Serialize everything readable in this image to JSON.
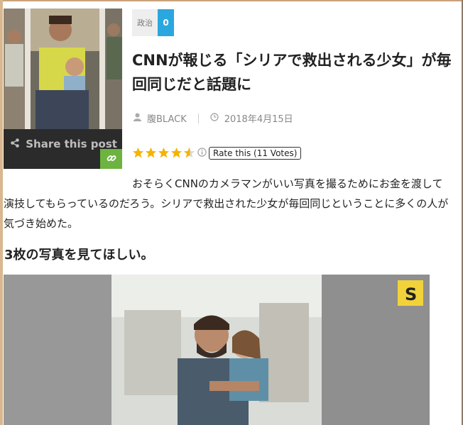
{
  "thumbnail": {
    "share_label": "Share this post",
    "icons": {
      "share": "share-icon",
      "link": "link-icon"
    }
  },
  "category": {
    "label": "政治",
    "count": "0"
  },
  "article": {
    "title": "CNNが報じる「シリアで救出される少女」が毎回同じだと話題に",
    "author": "腹BLACK",
    "date": "2018年4月15日",
    "body": "おそらくCNNのカメラマンがいい写真を撮るためにお金を渡して演技してもらっているのだろう。シリアで救出された少女が毎回同じということに多くの人が気づき始めた。",
    "subheading": "3枚の写真を見てほしい。"
  },
  "rating": {
    "stars": 4.5,
    "max": 5,
    "button_label": "Rate this (11 Votes)"
  },
  "colors": {
    "accent_blue": "#2aa7df",
    "link_green": "#6cb33f",
    "star_gold": "#f4b400",
    "video_badge": "#f1d23a"
  }
}
